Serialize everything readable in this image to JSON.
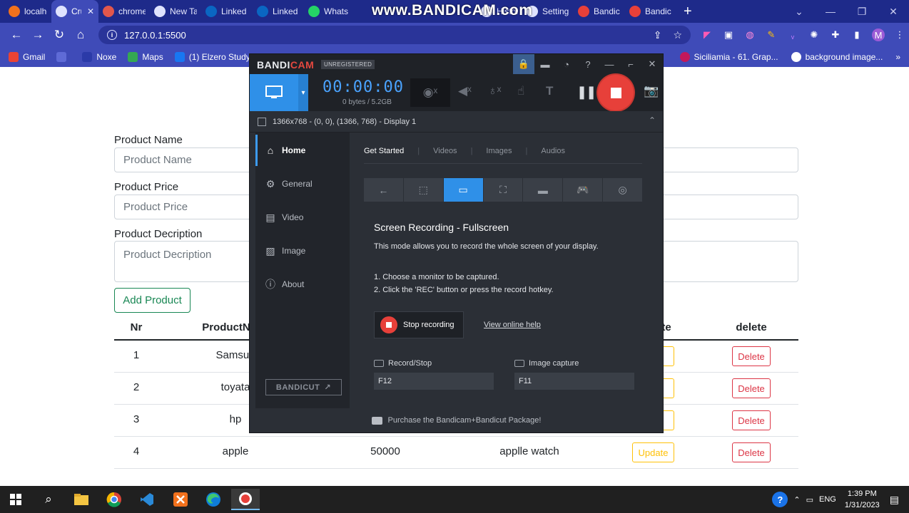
{
  "browser": {
    "watermark": "www.BANDICAM.com",
    "tabs": [
      {
        "label": "localho",
        "icon": "xampp-icon",
        "color": "#f2711c",
        "active": false
      },
      {
        "label": "Cru",
        "icon": "globe-icon",
        "color": "#dfe3ff",
        "active": true
      },
      {
        "label": "chrome",
        "icon": "chrome-icon",
        "color": "#e2574c",
        "active": false
      },
      {
        "label": "New Ta",
        "icon": "globe-icon",
        "color": "#dfe3ff",
        "active": false
      },
      {
        "label": "Linked",
        "icon": "linkedin-icon",
        "color": "#0a66c2",
        "active": false
      },
      {
        "label": "Linked",
        "icon": "linkedin-icon",
        "color": "#0a66c2",
        "active": false
      },
      {
        "label": "Whats",
        "icon": "whatsapp-icon",
        "color": "#25d366",
        "active": false
      },
      {
        "label": "History",
        "icon": "history-icon",
        "color": "#dfe3ff",
        "active": false
      },
      {
        "label": "Setting",
        "icon": "gear-icon",
        "color": "#dfe3ff",
        "active": false
      },
      {
        "label": "Bandic",
        "icon": "bandicam-icon",
        "color": "#e7403a",
        "active": false
      },
      {
        "label": "Bandic",
        "icon": "bandicam-icon",
        "color": "#e7403a",
        "active": false
      }
    ],
    "url": "127.0.0.1:5500",
    "avatar_letter": "M",
    "bookmarks": [
      {
        "label": "Gmail",
        "icon": "gmail-icon",
        "color": "#ea4335"
      },
      {
        "label": "",
        "icon": "globe-icon",
        "color": "#5f6bd6"
      },
      {
        "label": "Noxe",
        "icon": "react-icon",
        "color": "#2b3aa8"
      },
      {
        "label": "Maps",
        "icon": "maps-icon",
        "color": "#34a853"
      },
      {
        "label": "(1) Elzero Study G",
        "icon": "facebook-icon",
        "color": "#1877f2"
      }
    ],
    "bookmarks_right": [
      {
        "label": "Siciliamia - 61. Grap...",
        "icon": "siciliamia-icon",
        "color": "#c2185b"
      },
      {
        "label": "background image...",
        "icon": "google-icon",
        "color": "#ffffff"
      }
    ]
  },
  "form": {
    "name_label": "Product Name",
    "name_placeholder": "Product Name",
    "price_label": "Product Price",
    "price_placeholder": "Product Price",
    "desc_label": "Product Decription",
    "desc_placeholder": "Product Decription",
    "add_button": "Add Product"
  },
  "table": {
    "headers": [
      "Nr",
      "ProductN",
      "te",
      "delete"
    ],
    "rows": [
      {
        "nr": "1",
        "name": "Samsun",
        "price": "",
        "desc": "",
        "update": "",
        "delete": "Delete"
      },
      {
        "nr": "2",
        "name": "toyata",
        "price": "",
        "desc": "",
        "update": "",
        "delete": "Delete"
      },
      {
        "nr": "3",
        "name": "hp",
        "price": "",
        "desc": "",
        "update": "",
        "delete": "Delete"
      },
      {
        "nr": "4",
        "name": "apple",
        "price": "50000",
        "desc": "applle watch",
        "update": "Update",
        "delete": "Delete"
      }
    ]
  },
  "bandicam": {
    "logo_a": "BANDI",
    "logo_b": "CAM",
    "unregistered": "UNREGISTERED",
    "timer": "00:00:00",
    "bytes": "0 bytes / 5.2GB",
    "target": "1366x768 - (0, 0), (1366, 768) - Display 1",
    "nav": [
      "Home",
      "General",
      "Video",
      "Image",
      "About"
    ],
    "bandicut": "BANDICUT",
    "tabs": [
      "Get Started",
      "Videos",
      "Images",
      "Audios"
    ],
    "heading": "Screen Recording - Fullscreen",
    "description": "This mode allows you to record the whole screen of your display.",
    "step1": "1. Choose a monitor to be captured.",
    "step2": "2. Click the 'REC' button or press the record hotkey.",
    "stop_button": "Stop recording",
    "help_link": "View online help",
    "hotkey1_label": "Record/Stop",
    "hotkey1_value": "F12",
    "hotkey2_label": "Image capture",
    "hotkey2_value": "F11",
    "footer": "Purchase the Bandicam+Bandicut Package!",
    "accent": "#2f90e8",
    "rec_color": "#e7403a"
  },
  "taskbar": {
    "apps": [
      "windows-start-icon",
      "search-icon",
      "file-explorer-icon",
      "chrome-icon",
      "vscode-icon",
      "xampp-icon",
      "edge-icon",
      "bandicam-icon"
    ],
    "language": "ENG",
    "time": "1:39 PM",
    "date": "1/31/2023"
  }
}
